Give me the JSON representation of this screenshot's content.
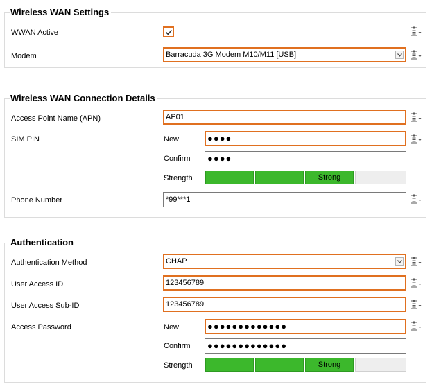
{
  "wwan": {
    "title": "Wireless WAN Settings",
    "active_label": "WWAN Active",
    "active_checked": true,
    "modem_label": "Modem",
    "modem_value": "Barracuda 3G Modem M10/M11 [USB]"
  },
  "connection": {
    "title": "Wireless WAN Connection Details",
    "apn_label": "Access Point Name (APN)",
    "apn_value": "AP01",
    "sim_label": "SIM PIN",
    "new_label": "New",
    "sim_new_value": "●●●●",
    "confirm_label": "Confirm",
    "sim_confirm_value": "●●●●",
    "strength_label": "Strength",
    "strength_text": "Strong",
    "strength_level": 0.75,
    "phone_label": "Phone Number",
    "phone_value": "*99***1"
  },
  "auth": {
    "title": "Authentication",
    "method_label": "Authentication Method",
    "method_value": "CHAP",
    "user_id_label": "User Access ID",
    "user_id_value": "123456789",
    "sub_id_label": "User Access Sub-ID",
    "sub_id_value": "123456789",
    "password_label": "Access Password",
    "new_label": "New",
    "password_new_value": "●●●●●●●●●●●●●",
    "confirm_label": "Confirm",
    "password_confirm_value": "●●●●●●●●●●●●●",
    "strength_label": "Strength",
    "strength_text": "Strong",
    "strength_level": 0.75
  },
  "colors": {
    "highlight": "#e07020",
    "strength_on": "#3cb82c",
    "strength_off": "#eeeeee"
  },
  "icons": {
    "row_menu": "clipboard-menu-icon",
    "checkmark": "checkmark-icon",
    "dropdown": "chevron-down-icon"
  }
}
